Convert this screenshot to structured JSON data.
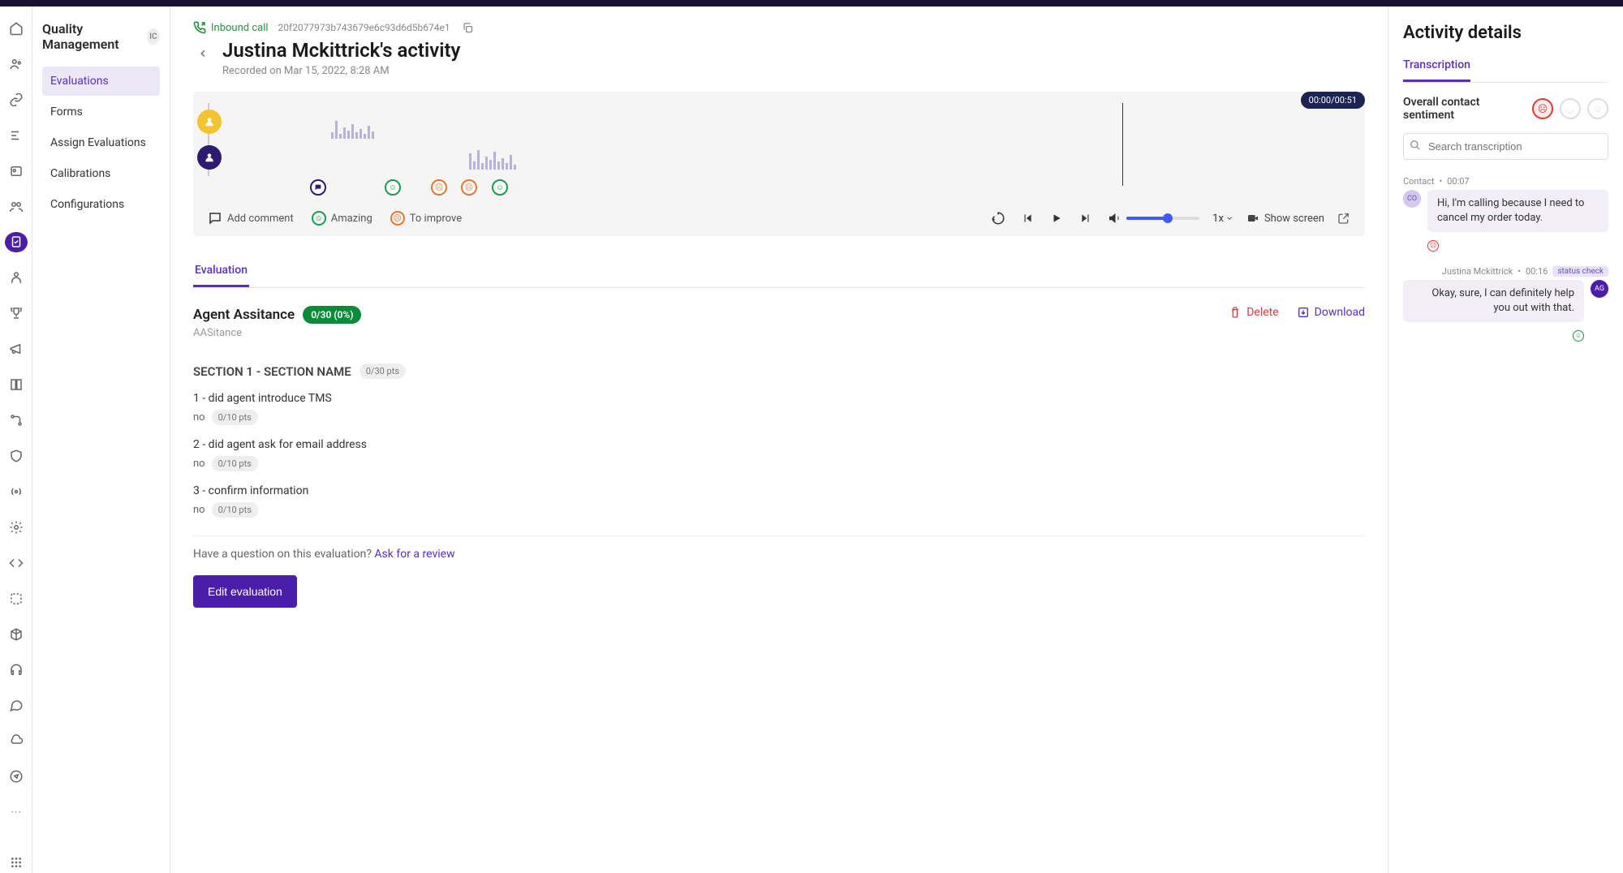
{
  "sidebar": {
    "title": "Quality Management",
    "chip": "IC",
    "items": [
      "Evaluations",
      "Forms",
      "Assign Evaluations",
      "Calibrations",
      "Configurations"
    ]
  },
  "header": {
    "call_type": "Inbound call",
    "call_id": "20f2077973b743679e6c93d6d5b674e1",
    "title": "Justina Mckittrick's activity",
    "subtitle": "Recorded on Mar 15, 2022, 8:28 AM"
  },
  "player": {
    "time": "00:00/00:51",
    "add_comment": "Add comment",
    "amazing": "Amazing",
    "to_improve": "To improve",
    "speed": "1x",
    "show_screen": "Show screen"
  },
  "tabs": {
    "evaluation": "Evaluation"
  },
  "evaluation": {
    "title": "Agent Assitance",
    "score": "0/30 (0%)",
    "subtitle": "AASitance",
    "delete": "Delete",
    "download": "Download",
    "section_title": "SECTION 1 - SECTION NAME",
    "section_pts": "0/30 pts",
    "questions": [
      {
        "q": "1 - did agent introduce TMS",
        "a": "no",
        "pts": "0/10 pts"
      },
      {
        "q": "2 - did agent ask for email address",
        "a": "no",
        "pts": "0/10 pts"
      },
      {
        "q": "3 - confirm information",
        "a": "no",
        "pts": "0/10 pts"
      }
    ],
    "review_prompt": "Have a question on this evaluation? ",
    "review_link": "Ask for a review",
    "edit_btn": "Edit evaluation"
  },
  "panel": {
    "title": "Activity details",
    "tab": "Transcription",
    "sentiment_label": "Overall contact sentiment",
    "search_placeholder": "Search transcription",
    "messages": [
      {
        "who": "Contact",
        "time": "00:07",
        "text": "Hi, I'm calling because I need to cancel my order today.",
        "avatar": "CO",
        "sentiment": "neg"
      },
      {
        "who": "Justina Mckittrick",
        "time": "00:16",
        "tag": "status check",
        "text": "Okay, sure, I can definitely help you out with that.",
        "avatar": "AG",
        "sentiment": "pos"
      }
    ]
  }
}
